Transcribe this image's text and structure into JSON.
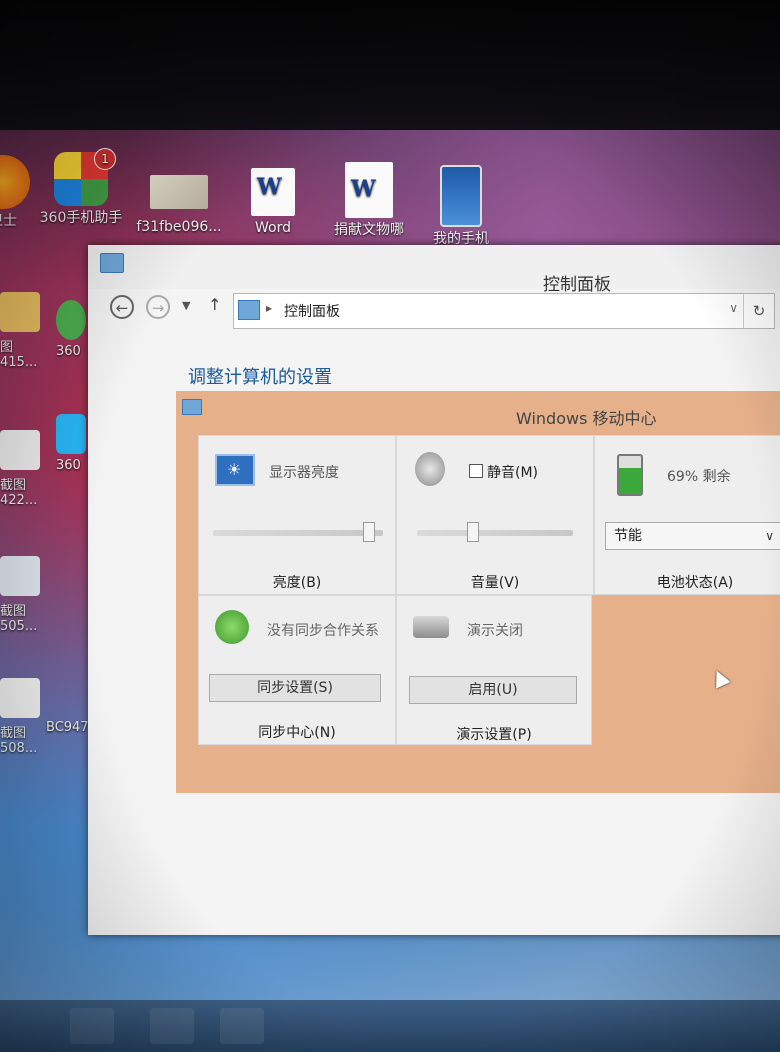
{
  "desktop_icons": [
    {
      "label": "卫士",
      "icon": "360-safe-icon"
    },
    {
      "label": "360手机助手",
      "icon": "360-mobile-assistant-icon",
      "badge": "1"
    },
    {
      "label": "f31fbe096...",
      "icon": "image-file-icon"
    },
    {
      "label": "Word",
      "icon": "word-shortcut-icon"
    },
    {
      "label": "捐献文物哪",
      "icon": "word-document-icon"
    },
    {
      "label": "我的手机",
      "icon": "my-phone-icon"
    }
  ],
  "side_icons": [
    {
      "label": "图",
      "sub": "415..."
    },
    {
      "label": "截图",
      "sub": "422..."
    },
    {
      "label": "截图",
      "sub": "505..."
    },
    {
      "label": "截图",
      "sub": "508..."
    }
  ],
  "side_icons_2": [
    {
      "label": "360"
    },
    {
      "label": "360"
    },
    {
      "label": "BC947"
    }
  ],
  "control_panel": {
    "title": "控制面板",
    "breadcrumb": "控制面板",
    "heading": "调整计算机的设置"
  },
  "mobility_center": {
    "title": "Windows 移动中心",
    "brightness": {
      "text": "显示器亮度",
      "label": "亮度(B)",
      "level": 0.95
    },
    "volume": {
      "mute_label": "静音(M)",
      "label": "音量(V)",
      "level": 0.35
    },
    "battery": {
      "text": "69% 剩余",
      "label": "电池状态(A)",
      "plan": "节能",
      "percent": 69
    },
    "sync": {
      "text": "没有同步合作关系",
      "button": "同步设置(S)",
      "label": "同步中心(N)"
    },
    "presentation": {
      "text": "演示关闭",
      "button": "启用(U)",
      "label": "演示设置(P)"
    }
  },
  "colors": {
    "mobility_bg": "#e6b08a",
    "heading": "#1a5aa0",
    "battery_green": "#3aa83a"
  }
}
